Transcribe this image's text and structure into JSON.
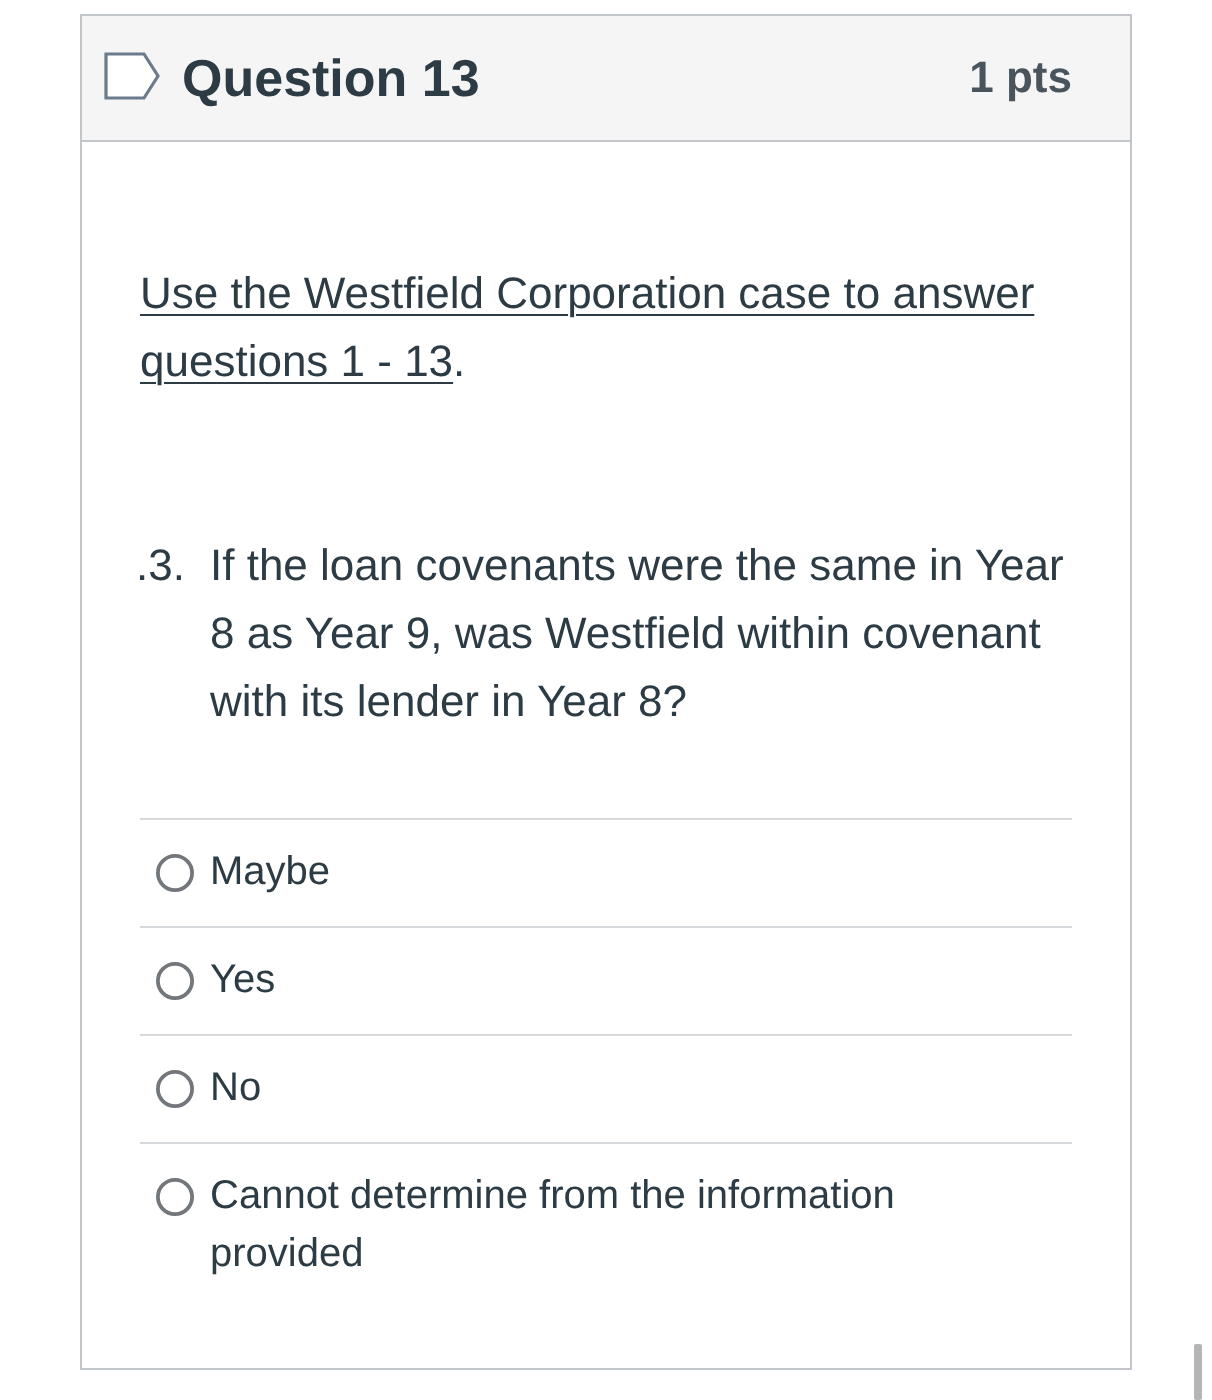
{
  "question": {
    "title": "Question 13",
    "points": "1 pts",
    "flagged": false
  },
  "intro": {
    "link": "Use the Westfield Corporation case to answer questions 1 - 13",
    "after": "."
  },
  "item": {
    "number": ".3.",
    "text": "If the loan covenants were the same in Year 8 as Year 9, was Westfield within covenant with its lender in Year 8?"
  },
  "answers": [
    {
      "label": "Maybe",
      "selected": false
    },
    {
      "label": "Yes",
      "selected": false
    },
    {
      "label": "No",
      "selected": false
    },
    {
      "label": "Cannot determine from the information provided",
      "selected": false
    }
  ]
}
